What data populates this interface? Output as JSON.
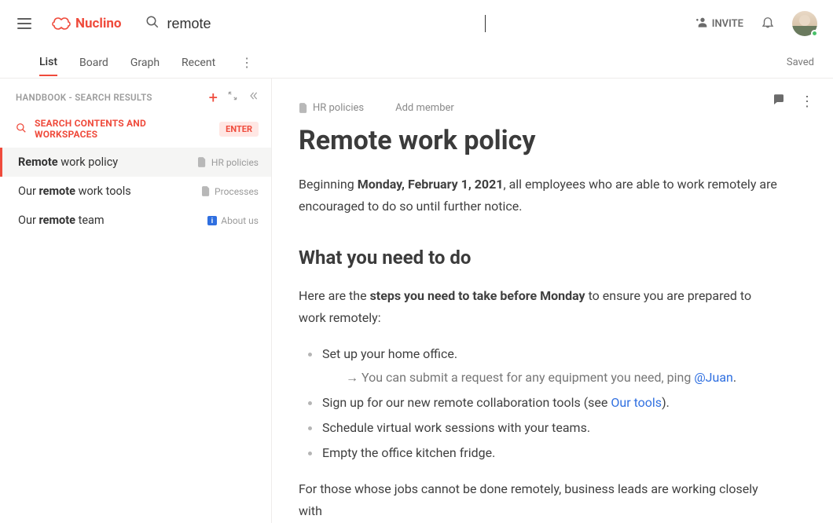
{
  "brand": {
    "name": "Nuclino"
  },
  "search": {
    "value": "remote"
  },
  "top": {
    "invite": "INVITE",
    "saved": "Saved"
  },
  "tabs": {
    "items": [
      "List",
      "Board",
      "Graph",
      "Recent"
    ],
    "active": 0
  },
  "sidebar": {
    "title": "HANDBOOK - SEARCH RESULTS",
    "hint_text": "SEARCH CONTENTS AND WORKSPACES",
    "enter_chip": "ENTER",
    "results": [
      {
        "pre": "Remote",
        "rest": " work policy",
        "collection": "HR policies",
        "icon": "gray",
        "active": true
      },
      {
        "pre_plain": "Our ",
        "bold": "remote",
        "rest": " work tools",
        "collection": "Processes",
        "icon": "gray",
        "active": false
      },
      {
        "pre_plain": "Our ",
        "bold": "remote",
        "rest": " team",
        "collection": "About us",
        "icon": "blue",
        "active": false
      }
    ]
  },
  "doc": {
    "crumb_collection": "HR policies",
    "add_member": "Add member",
    "title": "Remote work policy",
    "intro_pre": "Beginning ",
    "intro_bold": "Monday, February 1, 2021",
    "intro_post": ", all  employees who are able to work remotely are encouraged to do so until further notice.",
    "h2": "What you need to do",
    "steps_intro_pre": "Here are the ",
    "steps_intro_bold": "steps you need to take before Monday",
    "steps_intro_post": " to ensure you are prepared to work remotely:",
    "bullets": {
      "b1": "Set up your home office.",
      "b1_sub_pre": "→  You can submit a request for any equipment you need, ping ",
      "b1_sub_mention": "@Juan",
      "b1_sub_post": ".",
      "b2_pre": "Sign up for our new remote collaboration tools (see ",
      "b2_link": "Our tools",
      "b2_post": ").",
      "b3": "Schedule virtual work sessions with your teams.",
      "b4": "Empty the office kitchen fridge."
    },
    "outro": "For those whose jobs cannot be done remotely, business leads are working closely with"
  }
}
